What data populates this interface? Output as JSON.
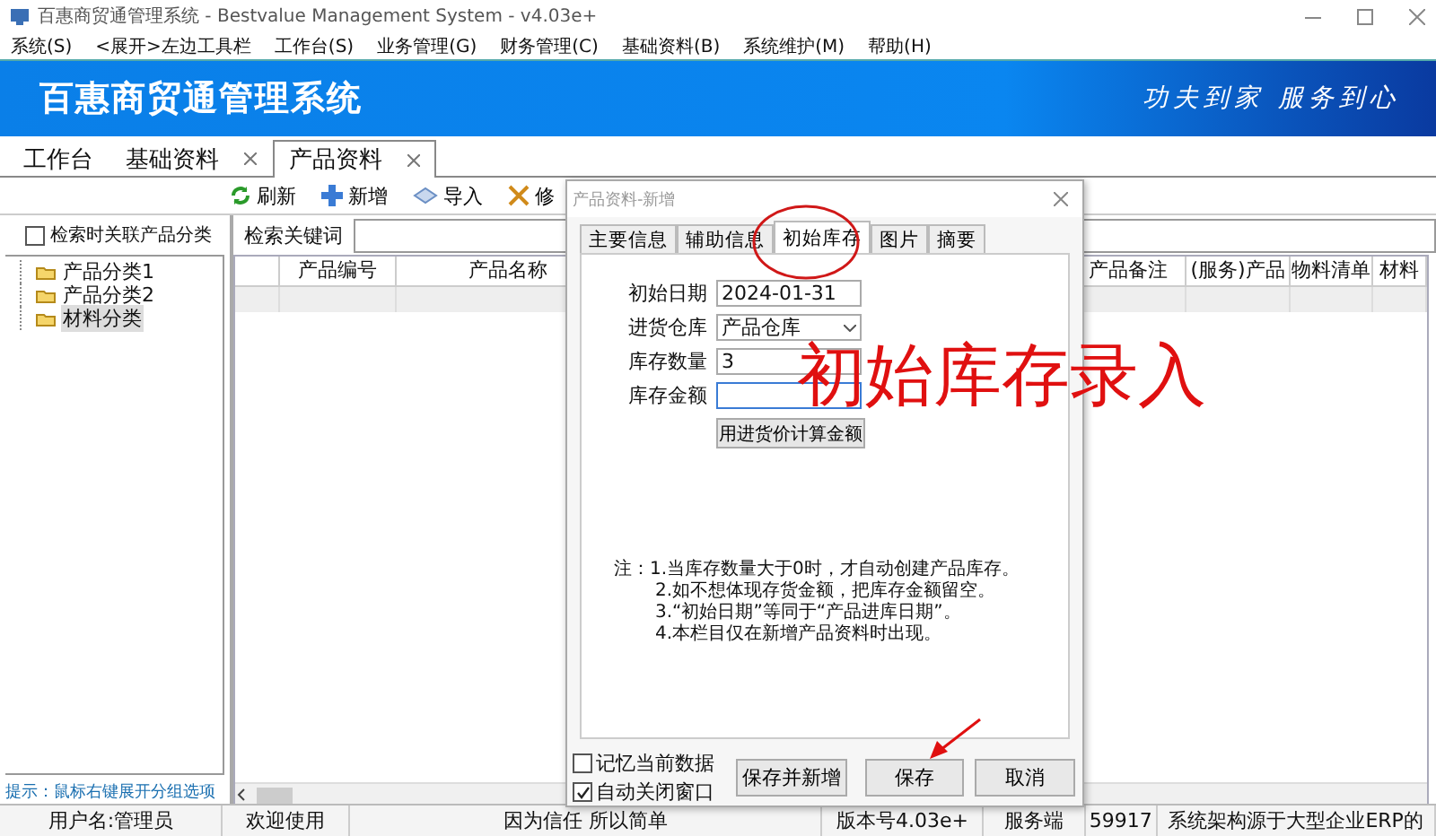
{
  "window": {
    "title": "百惠商贸通管理系统 - Bestvalue Management System - v4.03e+"
  },
  "menu": [
    "系统(S)",
    "<展开>左边工具栏",
    "工作台(S)",
    "业务管理(G)",
    "财务管理(C)",
    "基础资料(B)",
    "系统维护(M)",
    "帮助(H)"
  ],
  "banner": {
    "title": "百惠商贸通管理系统",
    "slogan": "功夫到家 服务到心"
  },
  "tabs": [
    {
      "label": "工作台",
      "selected": false,
      "closable": false
    },
    {
      "label": "基础资料",
      "selected": false,
      "closable": true
    },
    {
      "label": "产品资料",
      "selected": true,
      "closable": true
    }
  ],
  "toolbar": [
    {
      "label": "刷新",
      "kind": "refresh"
    },
    {
      "label": "新增",
      "kind": "add"
    },
    {
      "label": "导入",
      "kind": "import"
    },
    {
      "label": "修",
      "kind": "edit"
    }
  ],
  "left_panel": {
    "filter": {
      "label": "检索时关联产品分类",
      "checked": false
    },
    "tree": [
      {
        "label": "产品分类1",
        "selected": false
      },
      {
        "label": "产品分类2",
        "selected": false
      },
      {
        "label": "材料分类",
        "selected": true
      }
    ],
    "hint": "提示：鼠标右键展开分组选项"
  },
  "search": {
    "label": "检索关键词"
  },
  "table": {
    "columns": [
      "产品编号",
      "产品名称",
      "产品备注",
      "(服务)产品",
      "物料清单",
      "材料"
    ]
  },
  "status_bar": [
    "用户名:管理员",
    "欢迎使用",
    "因为信任 所以简单",
    "版本号4.03e+",
    "服务端",
    "59917",
    "系统架构源于大型企业ERP的"
  ],
  "dialog": {
    "title": "产品资料-新增",
    "tabs": [
      {
        "label": "主要信息",
        "selected": false
      },
      {
        "label": "辅助信息",
        "selected": false
      },
      {
        "label": "初始库存",
        "selected": true
      },
      {
        "label": "图片",
        "selected": false
      },
      {
        "label": "摘要",
        "selected": false
      }
    ],
    "fields": [
      {
        "label": "初始日期",
        "kind": "text",
        "value": "2024-01-31",
        "focused": false
      },
      {
        "label": "进货仓库",
        "kind": "select",
        "value": "产品仓库",
        "focused": false
      },
      {
        "label": "库存数量",
        "kind": "text",
        "value": "3",
        "focused": false
      },
      {
        "label": "库存金额",
        "kind": "text",
        "focused": true
      }
    ],
    "calc_button": "用进货价计算金额",
    "notes": [
      "注：1.当库存数量大于0时，才自动创建产品库存。",
      "2.如不想体现存货金额，把库存金额留空。",
      "3.“初始日期”等同于“产品进库日期”。",
      "4.本栏目仅在新增产品资料时出现。"
    ],
    "options": [
      {
        "label": "记忆当前数据",
        "checked": false
      },
      {
        "label": "自动关闭窗口",
        "checked": true
      }
    ],
    "buttons": [
      "保存并新增",
      "保存",
      "取消"
    ]
  },
  "annotation": {
    "text": "初始库存录入"
  }
}
